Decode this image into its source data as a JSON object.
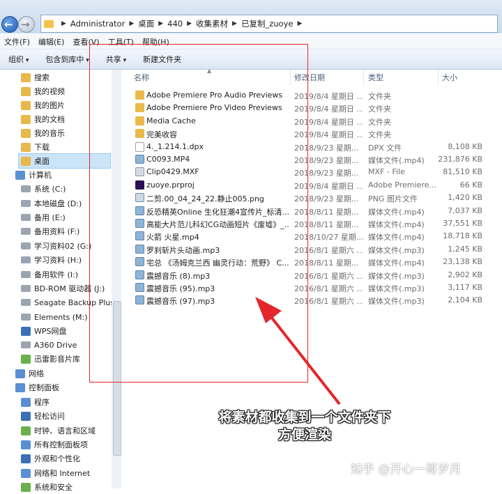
{
  "address": {
    "crumbs": [
      "Administrator",
      "桌面",
      "440",
      "收集素材",
      "已复制_zuoye"
    ]
  },
  "menu": [
    "文件(F)",
    "编辑(E)",
    "查看(V)",
    "工具(T)",
    "帮助(H)"
  ],
  "toolbar": {
    "organize": "组织",
    "include_library": "包含到库中",
    "share": "共享",
    "new_folder": "新建文件夹"
  },
  "nav": {
    "items": [
      {
        "label": "搜索",
        "icon": "folder-icon"
      },
      {
        "label": "我的视频",
        "icon": "folder-icon"
      },
      {
        "label": "我的图片",
        "icon": "folder-icon"
      },
      {
        "label": "我的文档",
        "icon": "folder-icon"
      },
      {
        "label": "我的音乐",
        "icon": "folder-icon"
      },
      {
        "label": "下载",
        "icon": "folder-icon"
      },
      {
        "label": "桌面",
        "icon": "folder-icon"
      },
      {
        "label": "计算机",
        "icon": "computer-icon"
      },
      {
        "label": "系统 (C:)",
        "icon": "drive-icon"
      },
      {
        "label": "本地磁盘 (D:)",
        "icon": "drive-icon"
      },
      {
        "label": "备用 (E:)",
        "icon": "drive-icon"
      },
      {
        "label": "备用资料 (F:)",
        "icon": "drive-icon"
      },
      {
        "label": "学习资料02 (G:)",
        "icon": "drive-icon"
      },
      {
        "label": "学习资料 (H:)",
        "icon": "drive-icon"
      },
      {
        "label": "备用软件 (I:)",
        "icon": "drive-icon"
      },
      {
        "label": "BD-ROM 驱动器 (J:)",
        "icon": "drive-icon"
      },
      {
        "label": "Seagate Backup Plus",
        "icon": "drive-icon"
      },
      {
        "label": "Elements (M:)",
        "icon": "drive-icon"
      },
      {
        "label": "WPS网盘",
        "icon": "cloud-icon"
      },
      {
        "label": "A360 Drive",
        "icon": "cloud-icon"
      },
      {
        "label": "迅雷影音片库",
        "icon": "video-icon"
      },
      {
        "label": "网络",
        "icon": "network-icon"
      },
      {
        "label": "控制面板",
        "icon": "control-panel-icon"
      },
      {
        "label": "程序",
        "icon": "program-icon"
      },
      {
        "label": "轻松访问",
        "icon": "access-icon"
      },
      {
        "label": "时钟、语言和区域",
        "icon": "clock-icon"
      },
      {
        "label": "所有控制面板项",
        "icon": "panel-icon"
      },
      {
        "label": "外观和个性化",
        "icon": "appearance-icon"
      },
      {
        "label": "网络和 Internet",
        "icon": "network-icon"
      },
      {
        "label": "系统和安全",
        "icon": "security-icon"
      }
    ]
  },
  "columns": {
    "name": "名称",
    "date": "修改日期",
    "type": "类型",
    "size": "大小"
  },
  "files": [
    {
      "name": "Adobe Premiere Pro Audio Previews",
      "date": "2019/8/4 星期日 ...",
      "type": "文件夹",
      "size": "",
      "kind": "folder"
    },
    {
      "name": "Adobe Premiere Pro Video Previews",
      "date": "2019/8/4 星期日 ...",
      "type": "文件夹",
      "size": "",
      "kind": "folder"
    },
    {
      "name": "Media Cache",
      "date": "2019/8/4 星期日 ...",
      "type": "文件夹",
      "size": "",
      "kind": "folder"
    },
    {
      "name": "完美收容",
      "date": "2019/8/4 星期日 ...",
      "type": "文件夹",
      "size": "",
      "kind": "folder"
    },
    {
      "name": "4._1.214.1.dpx",
      "date": "2018/9/23 星期...",
      "type": "DPX 文件",
      "size": "8,108 KB",
      "kind": "dpx"
    },
    {
      "name": "C0093.MP4",
      "date": "2018/9/23 星期...",
      "type": "媒体文件(.mp4)",
      "size": "231,876 KB",
      "kind": "media"
    },
    {
      "name": "Clip0429.MXF",
      "date": "2018/9/23 星期...",
      "type": "MXF - File",
      "size": "81,510 KB",
      "kind": "mxf"
    },
    {
      "name": "zuoye.prproj",
      "date": "2019/8/4 星期日 ...",
      "type": "Adobe Premiere...",
      "size": "66 KB",
      "kind": "pr"
    },
    {
      "name": "二剪.00_04_24_22.静止005.png",
      "date": "2018/9/23 星期...",
      "type": "PNG 图片文件",
      "size": "1,420 KB",
      "kind": "png"
    },
    {
      "name": "反恐精英Online 生化狂潮4宣传片_标清...",
      "date": "2018/8/11 星期...",
      "type": "媒体文件(.mp4)",
      "size": "7,037 KB",
      "kind": "media"
    },
    {
      "name": "高能大片范儿科幻CG动画短片《废墟》_...",
      "date": "2018/8/11 星期...",
      "type": "媒体文件(.mp4)",
      "size": "37,551 KB",
      "kind": "media"
    },
    {
      "name": "火箭 火星.mp4",
      "date": "2018/10/27 星期...",
      "type": "媒体文件(.mp4)",
      "size": "18,718 KB",
      "kind": "media"
    },
    {
      "name": "罗刹斩片头动画.mp3",
      "date": "2016/8/1 星期六 ...",
      "type": "媒体文件(.mp3)",
      "size": "1,245 KB",
      "kind": "media"
    },
    {
      "name": "宅总 《汤姆克兰西 幽灵行动：荒野》 C...",
      "date": "2018/8/11 星期...",
      "type": "媒体文件(.mp4)",
      "size": "23,138 KB",
      "kind": "media"
    },
    {
      "name": "震撼音乐 (8).mp3",
      "date": "2016/8/1 星期六 ...",
      "type": "媒体文件(.mp3)",
      "size": "2,902 KB",
      "kind": "media"
    },
    {
      "name": "震撼音乐 (95).mp3",
      "date": "2016/8/1 星期六 ...",
      "type": "媒体文件(.mp3)",
      "size": "3,117 KB",
      "kind": "media"
    },
    {
      "name": "震撼音乐 (97).mp3",
      "date": "2016/8/1 星期六 ...",
      "type": "媒体文件(.mp3)",
      "size": "2,104 KB",
      "kind": "media"
    }
  ],
  "annotation": {
    "caption_line1": "将素材都收集到一个文件夹下",
    "caption_line2": "方便渲染",
    "color": "#e2262b"
  },
  "watermark": "知乎 @开心一哥岁月"
}
